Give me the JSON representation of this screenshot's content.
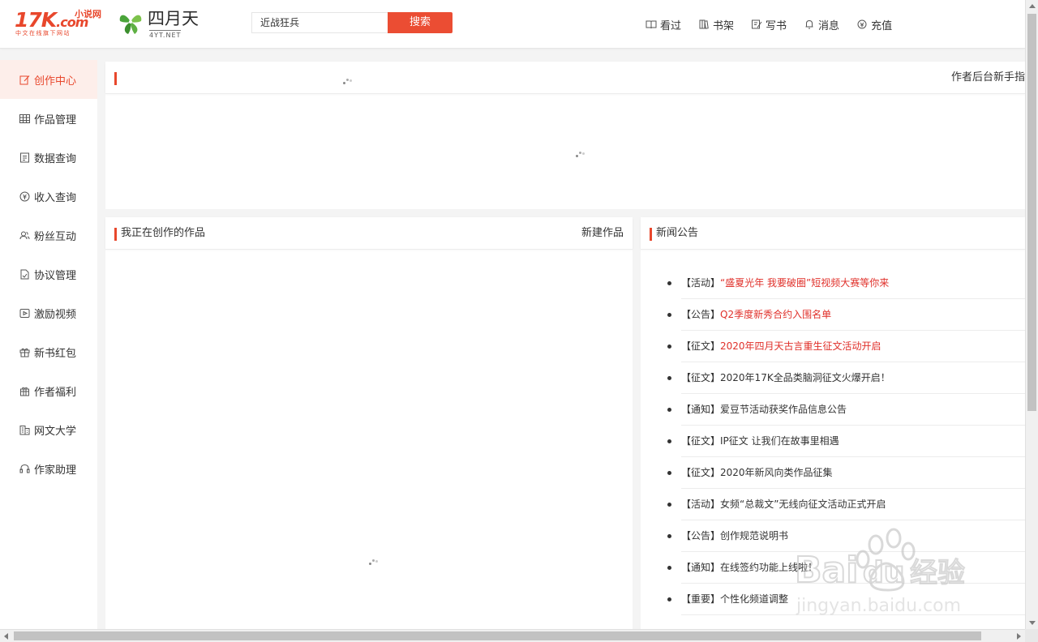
{
  "header": {
    "logo_17k": {
      "main": "17K",
      "dotcom": ".com",
      "top": "小说网",
      "sub": "中文在线旗下网站"
    },
    "logo_4yt": {
      "name": "四月天",
      "url": "4YT.NET"
    },
    "search": {
      "value": "近战狂兵",
      "button_label": "搜索"
    },
    "nav": [
      {
        "icon": "book-open-icon",
        "label": "看过"
      },
      {
        "icon": "bookshelf-icon",
        "label": "书架"
      },
      {
        "icon": "write-icon",
        "label": "写书"
      },
      {
        "icon": "bell-icon",
        "label": "消息"
      },
      {
        "icon": "recharge-icon",
        "label": "充值"
      }
    ]
  },
  "sidebar": {
    "items": [
      {
        "icon": "edit-icon",
        "label": "创作中心",
        "active": true
      },
      {
        "icon": "table-icon",
        "label": "作品管理"
      },
      {
        "icon": "document-icon",
        "label": "数据查询"
      },
      {
        "icon": "yen-icon",
        "label": "收入查询"
      },
      {
        "icon": "users-icon",
        "label": "粉丝互动"
      },
      {
        "icon": "contract-icon",
        "label": "协议管理"
      },
      {
        "icon": "video-icon",
        "label": "激励视频"
      },
      {
        "icon": "gift-icon",
        "label": "新书红包"
      },
      {
        "icon": "gift-box-icon",
        "label": "作者福利"
      },
      {
        "icon": "building-icon",
        "label": "网文大学"
      },
      {
        "icon": "headset-icon",
        "label": "作家助理"
      }
    ]
  },
  "top_panel": {
    "right_link": "作者后台新手指"
  },
  "works_panel": {
    "title": "我正在创作的作品",
    "action": "新建作品"
  },
  "news_panel": {
    "title": "新闻公告",
    "items": [
      {
        "tag": "【活动】",
        "title": "“盛夏光年 我要破圈”短视频大赛等你来",
        "highlight": true
      },
      {
        "tag": "【公告】",
        "title": "Q2季度新秀合约入围名单",
        "highlight": true
      },
      {
        "tag": "【征文】",
        "title": "2020年四月天古言重生征文活动开启",
        "highlight": true
      },
      {
        "tag": "【征文】",
        "title": "2020年17K全品类脑洞征文火爆开启！",
        "highlight": false
      },
      {
        "tag": "【通知】",
        "title": "爱豆节活动获奖作品信息公告",
        "highlight": false
      },
      {
        "tag": "【征文】",
        "title": "IP征文 让我们在故事里相遇",
        "highlight": false
      },
      {
        "tag": "【征文】",
        "title": "2020年新风向类作品征集",
        "highlight": false
      },
      {
        "tag": "【活动】",
        "title": "女频“总裁文”无线向征文活动正式开启",
        "highlight": false
      },
      {
        "tag": "【公告】",
        "title": "创作规范说明书",
        "highlight": false
      },
      {
        "tag": "【通知】",
        "title": "在线签约功能上线啦！",
        "highlight": false
      },
      {
        "tag": "【重要】",
        "title": "个性化频道调整",
        "highlight": false
      }
    ]
  },
  "watermark": {
    "brand": "Bai",
    "brand2": "du",
    "cn": "经验",
    "url": "jingyan.baidu.com"
  },
  "colors": {
    "accent": "#e8472c",
    "highlight_text": "#e0302a",
    "active_bg": "#fdeeea"
  }
}
